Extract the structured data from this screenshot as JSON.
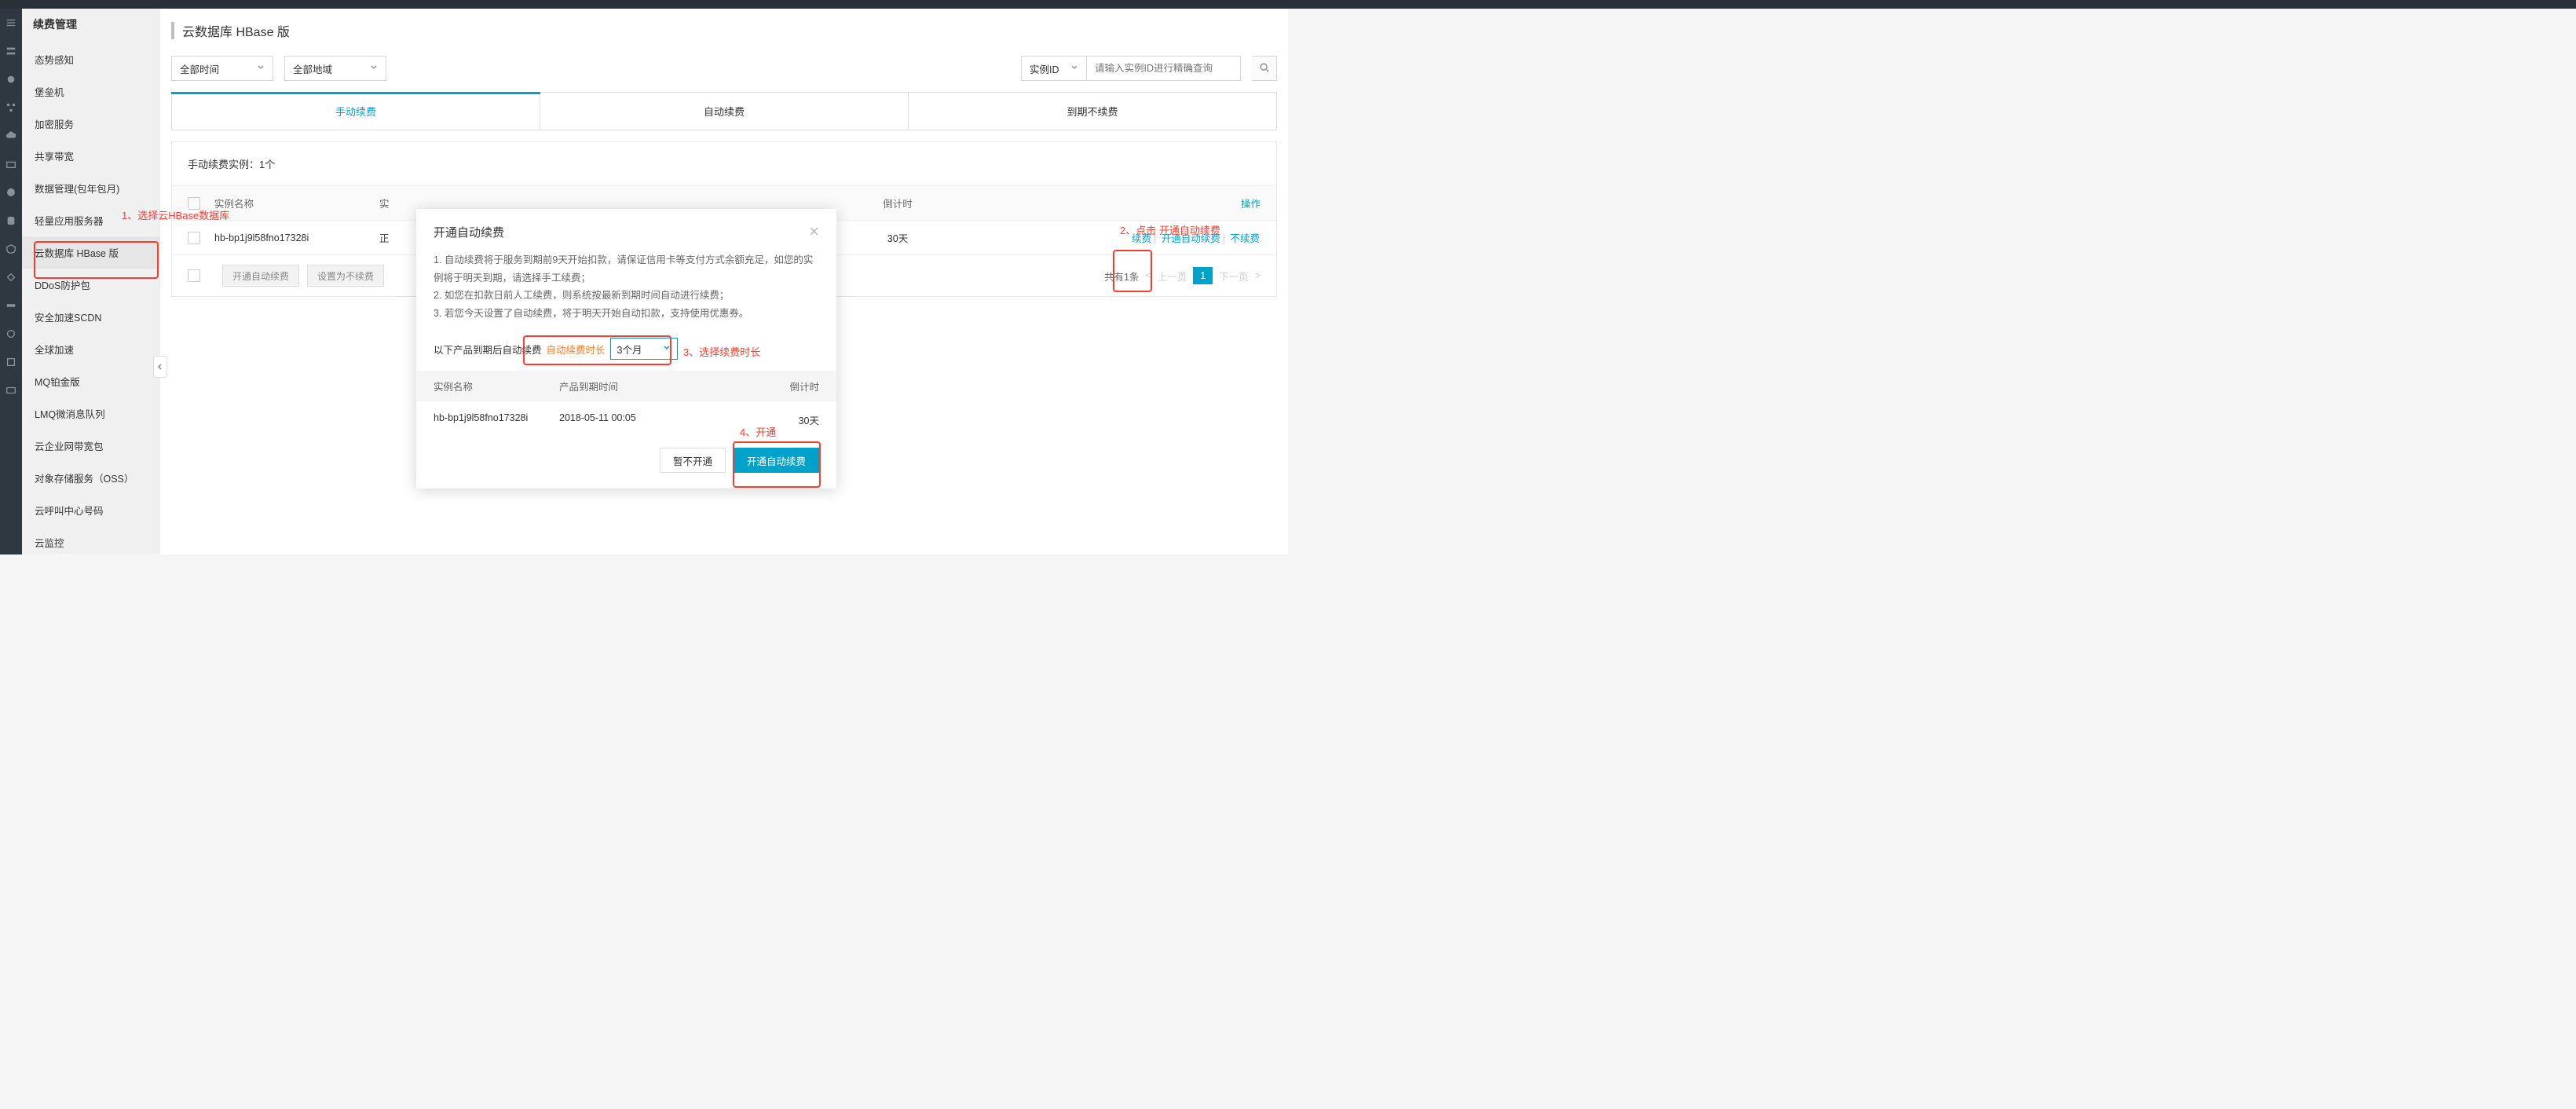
{
  "sidebar": {
    "title": "续费管理",
    "items": [
      {
        "label": "态势感知"
      },
      {
        "label": "堡垒机"
      },
      {
        "label": "加密服务"
      },
      {
        "label": "共享带宽"
      },
      {
        "label": "数据管理(包年包月)"
      },
      {
        "label": "轻量应用服务器"
      },
      {
        "label": "云数据库 HBase 版"
      },
      {
        "label": "DDoS防护包"
      },
      {
        "label": "安全加速SCDN"
      },
      {
        "label": "全球加速"
      },
      {
        "label": "MQ铂金版"
      },
      {
        "label": "LMQ微消息队列"
      },
      {
        "label": "云企业网带宽包"
      },
      {
        "label": "对象存储服务（OSS）"
      },
      {
        "label": "云呼叫中心号码"
      },
      {
        "label": "云监控"
      }
    ]
  },
  "header": {
    "title": "云数据库 HBase 版"
  },
  "filters": {
    "time": "全部时间",
    "region": "全部地域",
    "search_type": "实例ID",
    "search_placeholder": "请输入实例ID进行精确查询"
  },
  "tabs": {
    "manual": "手动续费",
    "auto": "自动续费",
    "none": "到期不续费"
  },
  "panel": {
    "summary": "手动续费实例：1个",
    "columns": {
      "name": "实例名称",
      "status": "实",
      "countdown": "倒计时",
      "actions": "操作"
    },
    "row": {
      "name": "hb-bp1j9l58fno17328i",
      "status_prefix": "正",
      "countdown": "30天",
      "actions": {
        "renew": "续费",
        "auto": "开通自动续费",
        "stop": "不续费"
      }
    },
    "bulk": {
      "auto": "开通自动续费",
      "stop": "设置为不续费"
    },
    "pager": {
      "total": "共有1条",
      "prev": "上一页",
      "page": "1",
      "next": "下一页"
    }
  },
  "modal": {
    "title": "开通自动续费",
    "notes": [
      "1. 自动续费将于服务到期前9天开始扣款，请保证信用卡等支付方式余额充足，如您的实例将于明天到期，请选择手工续费；",
      "2. 如您在扣款日前人工续费，则系统按最新到期时间自动进行续费；",
      "3. 若您今天设置了自动续费，将于明天开始自动扣款，支持使用优惠券。"
    ],
    "mid_label": "以下产品到期后自动续费",
    "mid_label2": "自动续费时长",
    "duration": "3个月",
    "cols": {
      "name": "实例名称",
      "expire": "产品到期时间",
      "countdown": "倒计时"
    },
    "row": {
      "name": "hb-bp1j9l58fno17328i",
      "expire": "2018-05-11 00:05",
      "countdown": "30天"
    },
    "btn_cancel": "暂不开通",
    "btn_ok": "开通自动续费"
  },
  "anno": {
    "a1": "1、选择云HBase数据库",
    "a2": "2、点击 开通自动续费",
    "a3": "3、选择续费时长",
    "a4": "4、开通"
  }
}
